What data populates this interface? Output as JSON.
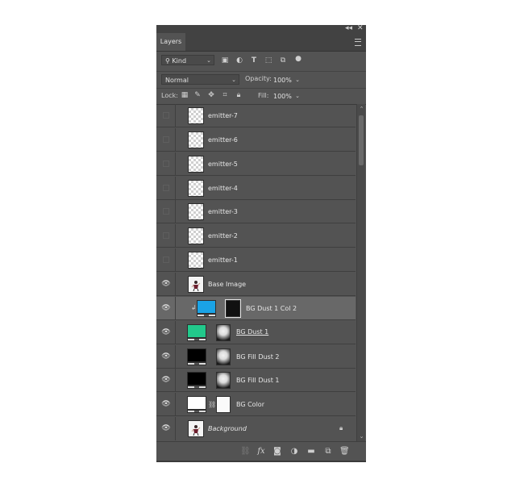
{
  "panel": {
    "tab_label": "Layers",
    "collapse_glyph": "◂◂",
    "close_glyph": "✕",
    "filter": {
      "kind_label": "Kind"
    },
    "blend": {
      "mode": "Normal",
      "opacity_label": "Opacity:",
      "opacity_value": "100%"
    },
    "lock": {
      "label": "Lock:",
      "fill_label": "Fill:",
      "fill_value": "100%"
    },
    "layers": [
      {
        "name": "emitter-7",
        "visible": false,
        "thumb": "transparent"
      },
      {
        "name": "emitter-6",
        "visible": false,
        "thumb": "transparent"
      },
      {
        "name": "emitter-5",
        "visible": false,
        "thumb": "transparent"
      },
      {
        "name": "emitter-4",
        "visible": false,
        "thumb": "transparent"
      },
      {
        "name": "emitter-3",
        "visible": false,
        "thumb": "transparent"
      },
      {
        "name": "emitter-2",
        "visible": false,
        "thumb": "transparent"
      },
      {
        "name": "emitter-1",
        "visible": false,
        "thumb": "transparent"
      },
      {
        "name": "Base Image",
        "visible": true,
        "thumb": "figure"
      },
      {
        "name": "BG Dust 1 Col 2",
        "visible": true,
        "thumb": "fill",
        "fill_color": "#1aa3e6",
        "mask": "black",
        "clipped": true,
        "selected": true
      },
      {
        "name": "BG Dust 1",
        "visible": true,
        "thumb": "fill",
        "fill_color": "#22c98b",
        "mask": "dust",
        "underlined": true
      },
      {
        "name": "BG Fill Dust 2",
        "visible": true,
        "thumb": "fill",
        "fill_color": "#000000",
        "mask": "dust"
      },
      {
        "name": "BG Fill Dust 1",
        "visible": true,
        "thumb": "fill",
        "fill_color": "#000000",
        "mask": "dust"
      },
      {
        "name": "BG Color",
        "visible": true,
        "thumb": "fill",
        "fill_color": "#ffffff",
        "mask": "white",
        "linked": true
      },
      {
        "name": "Background",
        "visible": true,
        "thumb": "figure",
        "italic": true,
        "locked": true
      }
    ],
    "bottom_icons": [
      "link-layers-icon",
      "fx-icon",
      "add-mask-icon",
      "adjustment-layer-icon",
      "new-group-icon",
      "new-layer-icon",
      "delete-layer-icon"
    ]
  },
  "colors": {
    "panel_bg": "#535353",
    "selected_row": "#686868",
    "text": "#e6e6e6"
  }
}
